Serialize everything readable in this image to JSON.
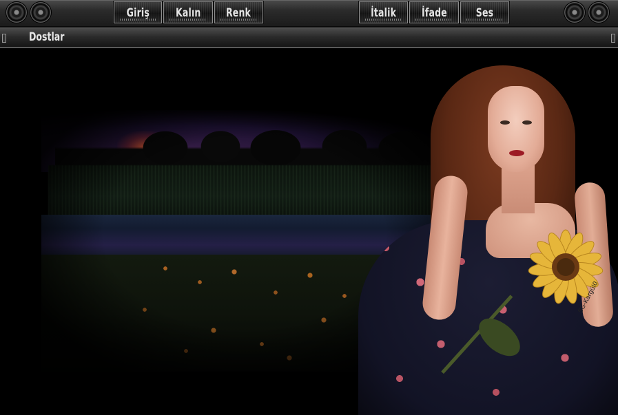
{
  "toolbar": {
    "left_buttons": [
      "Giriş",
      "Kalın",
      "Renk"
    ],
    "right_buttons": [
      "İtalik",
      "İfade",
      "Ses"
    ]
  },
  "titlebar": {
    "title": "Dostlar"
  },
  "scene": {
    "description_icons": [
      "speaker-icon",
      "sunflower-icon"
    ],
    "watermark": "SG-Kargül0"
  },
  "colors": {
    "toolbar_bg": "#2b2b2b",
    "button_text": "#e4e4e4",
    "background": "#000000"
  }
}
